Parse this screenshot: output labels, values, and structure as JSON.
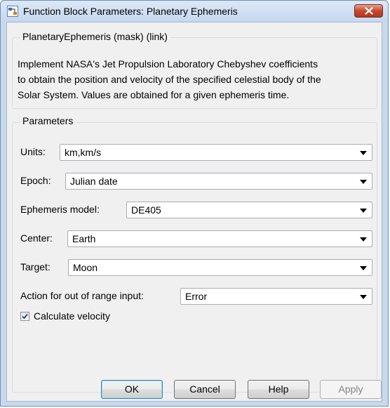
{
  "window": {
    "title": "Function Block Parameters: Planetary Ephemeris",
    "icons": {
      "app": "simulink-block-icon",
      "close": "close-icon"
    }
  },
  "block": {
    "header": "PlanetaryEphemeris (mask) (link)",
    "description_lines": [
      "Implement NASA's Jet Propulsion Laboratory Chebyshev coefficients",
      "to obtain the position and velocity of the specified celestial body of the",
      "Solar System. Values are obtained for a given ephemeris time."
    ]
  },
  "parameters": {
    "legend": "Parameters",
    "units": {
      "label": "Units:",
      "value": "km,km/s"
    },
    "epoch": {
      "label": "Epoch:",
      "value": "Julian date"
    },
    "ephemeris_model": {
      "label": "Ephemeris model:",
      "value": "DE405"
    },
    "center": {
      "label": "Center:",
      "value": "Earth"
    },
    "target": {
      "label": "Target:",
      "value": "Moon"
    },
    "out_of_range": {
      "label": "Action for out of range input:",
      "value": "Error"
    },
    "calculate_velocity": {
      "label": "Calculate velocity",
      "checked": true
    }
  },
  "buttons": {
    "ok": "OK",
    "cancel": "Cancel",
    "help": "Help",
    "apply": "Apply"
  },
  "colors": {
    "close_button": "#c8482f",
    "frame": "#c8d9ee",
    "panel": "#f0f0f0"
  }
}
